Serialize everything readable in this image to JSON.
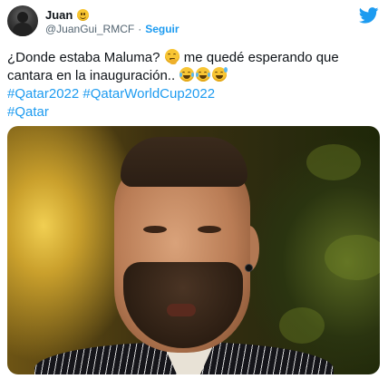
{
  "user": {
    "display_name": "Juan",
    "name_emoji_icon": "slightly-smiling-face-icon",
    "handle": "@JuanGui_RMCF",
    "separator": "·",
    "follow_label": "Seguir",
    "brand_icon": "twitter-bird-icon"
  },
  "tweet": {
    "line1_text_a": "¿Donde estaba Maluma? ",
    "line1_emoji": "thinking-face-icon",
    "line1_text_b": " me quedé esperando que",
    "line2_text": "cantara en la inauguración.. ",
    "line2_emojis": [
      "face-with-tears-of-joy-icon",
      "face-with-tears-of-joy-icon",
      "grinning-face-with-sweat-icon"
    ],
    "hashtags_line1": [
      "#Qatar2022",
      "#QatarWorldCup2022"
    ],
    "hashtags_line2": [
      "#Qatar"
    ]
  },
  "colors": {
    "accent": "#1d9bf0",
    "text": "#0f1419",
    "secondary": "#536471"
  }
}
